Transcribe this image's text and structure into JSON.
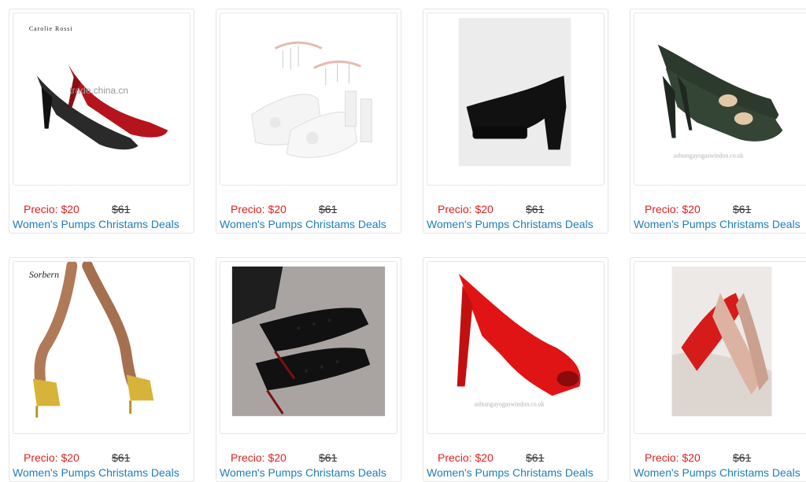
{
  "products": [
    {
      "image": "black-red-pumps",
      "price": "Precio: $20",
      "old_price": "$61",
      "title": "Women's Pumps Christams Deals",
      "brand": "Carolie Rossi",
      "watermark": "trade.china.cn"
    },
    {
      "image": "white-bridal-heels",
      "price": "Precio: $20",
      "old_price": "$61",
      "title": "Women's Pumps Christams Deals"
    },
    {
      "image": "black-platform-pump",
      "price": "Precio: $20",
      "old_price": "$61",
      "title": "Women's Pumps Christams Deals"
    },
    {
      "image": "green-snakeskin-pumps",
      "price": "Precio: $20",
      "old_price": "$61",
      "title": "Women's Pumps Christams Deals",
      "watermark": "ashtangayogaswindon.co.uk"
    },
    {
      "image": "yellow-strappy-sandals",
      "price": "Precio: $20",
      "old_price": "$61",
      "title": "Women's Pumps Christams Deals",
      "brand": "Sorbern"
    },
    {
      "image": "black-spiked-pumps",
      "price": "Precio: $20",
      "old_price": "$61",
      "title": "Women's Pumps Christams Deals"
    },
    {
      "image": "red-peep-toe-pump",
      "price": "Precio: $20",
      "old_price": "$61",
      "title": "Women's Pumps Christams Deals",
      "watermark": "ashtangayogaswindon.co.uk"
    },
    {
      "image": "nude-red-sole-pumps",
      "price": "Precio: $20",
      "old_price": "$61",
      "title": "Women's Pumps Christams Deals"
    }
  ]
}
